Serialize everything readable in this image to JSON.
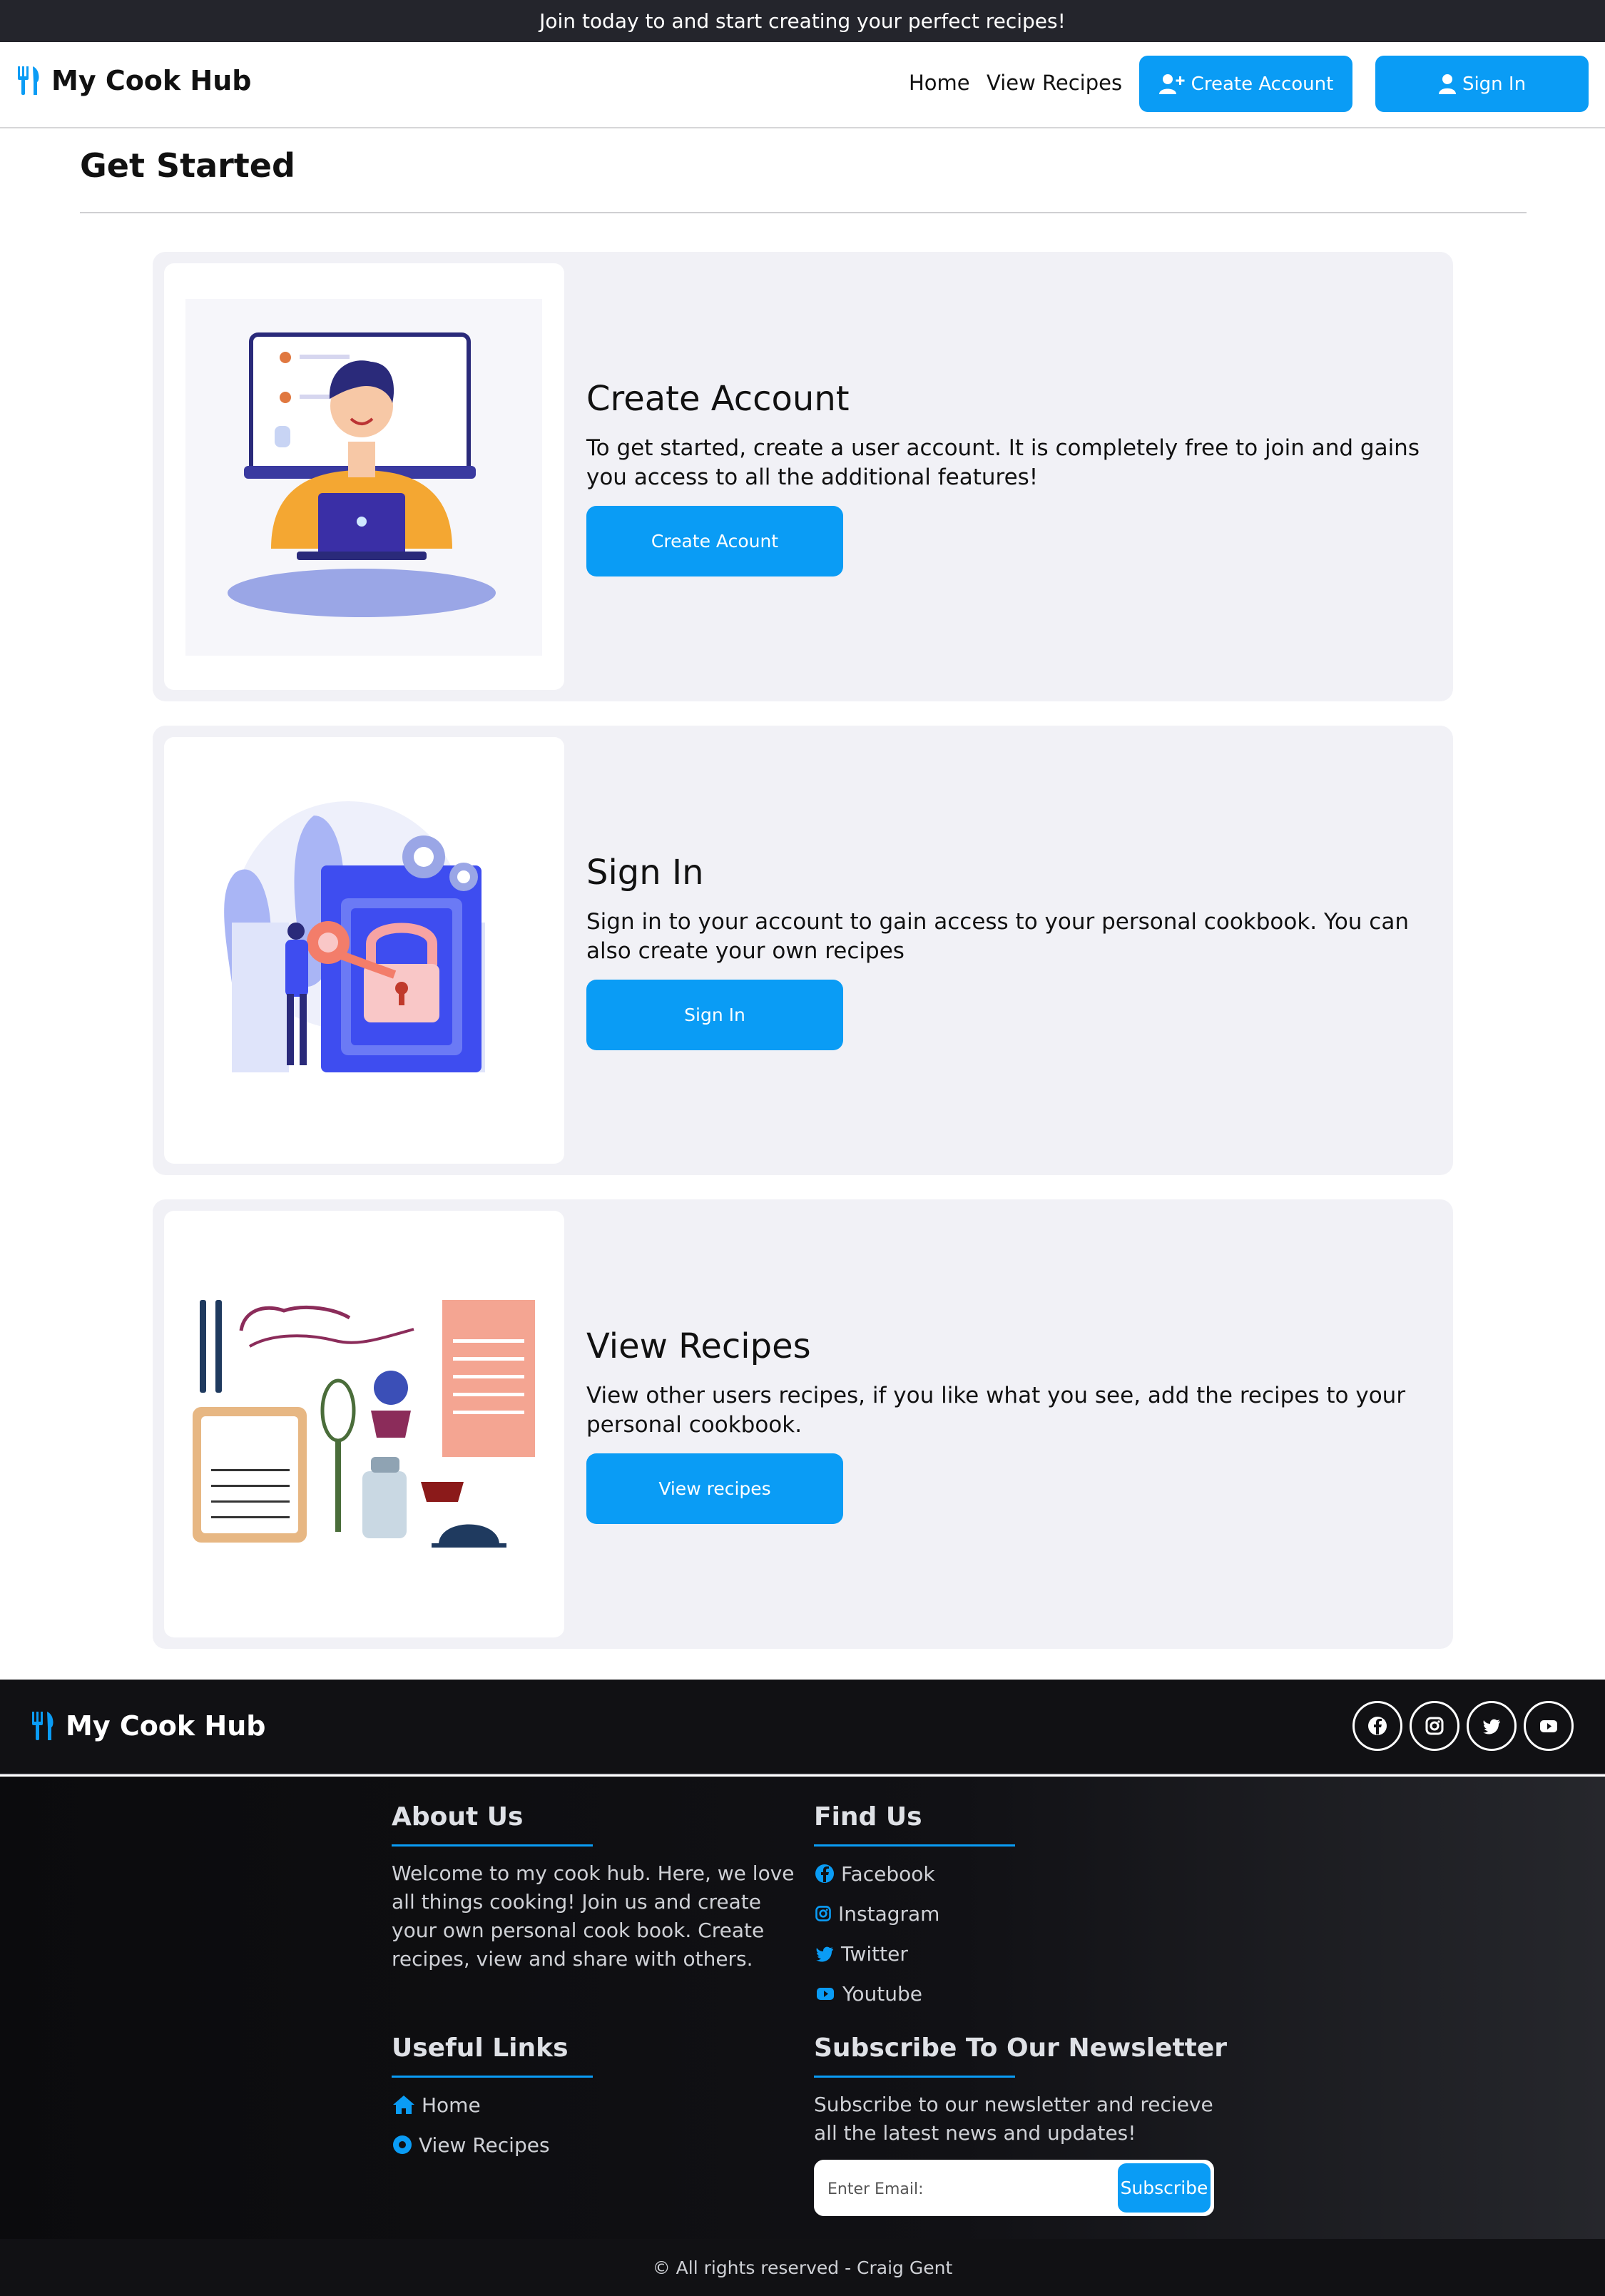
{
  "announcement": "Join today to and start creating your perfect recipes!",
  "brand": {
    "name": "My Cook Hub",
    "icon": "utensils-icon"
  },
  "nav": {
    "home": "Home",
    "view_recipes": "View Recipes",
    "create_account": "Create Account",
    "sign_in": "Sign In"
  },
  "page_title": "Get Started",
  "cards": [
    {
      "title": "Create Account",
      "text": "To get started, create a user account. It is completely free to join and gains you access to all the additional features!",
      "button": "Create Acount"
    },
    {
      "title": "Sign In",
      "text": "Sign in to your account to gain access to your personal cookbook. You can also create your own recipes",
      "button": "Sign In"
    },
    {
      "title": "View Recipes",
      "text": "View other users recipes, if you like what you see, add the recipes to your personal cookbook.",
      "button": "View recipes"
    }
  ],
  "footer": {
    "brand": "My Cook Hub",
    "social_icons": [
      "facebook-icon",
      "instagram-icon",
      "twitter-icon",
      "youtube-icon"
    ],
    "about": {
      "heading": "About Us",
      "text": "Welcome to my cook hub. Here, we love all things cooking! Join us and create your own personal cook book. Create recipes, view and share with others."
    },
    "find_us": {
      "heading": "Find Us",
      "links": [
        "Facebook",
        "Instagram",
        "Twitter",
        "Youtube"
      ]
    },
    "useful_links": {
      "heading": "Useful Links",
      "links": [
        "Home",
        "View Recipes"
      ]
    },
    "newsletter": {
      "heading": "Subscribe To Our Newsletter",
      "text": "Subscribe to our newsletter and recieve all the latest news and updates!",
      "placeholder": "Enter Email:",
      "button": "Subscribe"
    },
    "copyright": "© All rights reserved - Craig Gent"
  },
  "colors": {
    "accent": "#0a9cf5",
    "dark": "#24252c",
    "card_bg": "#f1f1f6"
  }
}
